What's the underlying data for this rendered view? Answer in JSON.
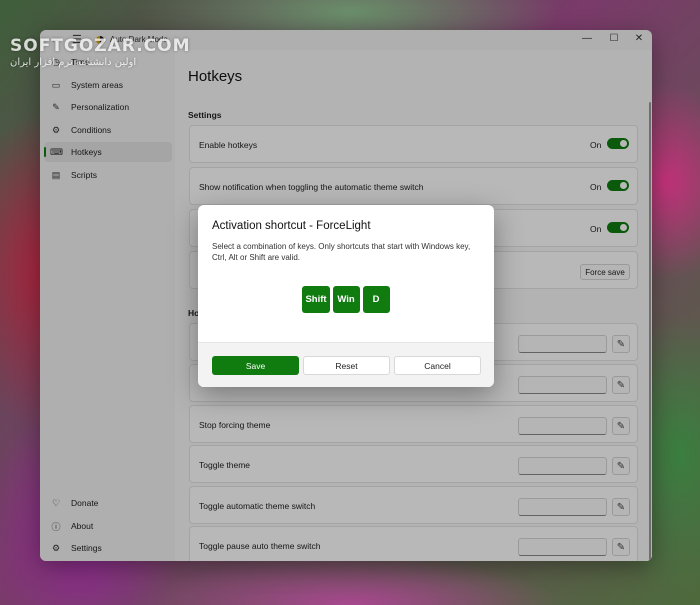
{
  "app": {
    "title": "Auto Dark Mode"
  },
  "titlebar": {
    "back_glyph": "←",
    "menu_glyph": "☰",
    "minimize_glyph": "—",
    "maximize_glyph": "☐",
    "close_glyph": "✕"
  },
  "nav": {
    "items": [
      {
        "label": "Time",
        "icon": "clock-icon",
        "glyph": "◷"
      },
      {
        "label": "System areas",
        "icon": "monitor-icon",
        "glyph": "▭"
      },
      {
        "label": "Personalization",
        "icon": "pen-icon",
        "glyph": "✎"
      },
      {
        "label": "Conditions",
        "icon": "settings-icon",
        "glyph": "⚙"
      },
      {
        "label": "Hotkeys",
        "icon": "keyboard-icon",
        "glyph": "⌨",
        "selected": true
      },
      {
        "label": "Scripts",
        "icon": "document-icon",
        "glyph": "▤"
      }
    ],
    "bottom_items": [
      {
        "label": "Donate",
        "icon": "heart-icon",
        "glyph": "♡"
      },
      {
        "label": "About",
        "icon": "info-icon",
        "glyph": "ⓘ"
      },
      {
        "label": "Settings",
        "icon": "gear-icon",
        "glyph": "⚙"
      }
    ]
  },
  "page": {
    "title": "Hotkeys",
    "settings_header": "Settings",
    "hotkeys_header": "Ho",
    "settings": [
      {
        "label": "Enable hotkeys",
        "state": "On",
        "enabled": true
      },
      {
        "label": "Show notification when toggling the automatic theme switch",
        "state": "On",
        "enabled": true
      },
      {
        "label": "",
        "state": "On",
        "enabled": true
      }
    ],
    "force_save_label": "Force save",
    "hotkey_rows": [
      {
        "label": "",
        "value": ""
      },
      {
        "label": "",
        "value": ""
      },
      {
        "label": "Stop forcing theme",
        "value": ""
      },
      {
        "label": "Toggle theme",
        "value": ""
      },
      {
        "label": "Toggle automatic theme switch",
        "value": ""
      },
      {
        "label": "Toggle pause auto theme switch",
        "value": ""
      }
    ],
    "edit_glyph": "✎"
  },
  "dialog": {
    "title": "Activation shortcut - ForceLight",
    "description": "Select a combination of keys. Only shortcuts that start with Windows key, Ctrl, Alt or Shift are valid.",
    "keys": [
      "Shift",
      "Win",
      "D"
    ],
    "buttons": {
      "save": "Save",
      "reset": "Reset",
      "cancel": "Cancel"
    }
  },
  "watermark": {
    "main": "SOFTGOZAR.COM",
    "sub": "اولین دانشنامه نرم افزار ایران"
  },
  "colors": {
    "accent": "#107c10"
  }
}
